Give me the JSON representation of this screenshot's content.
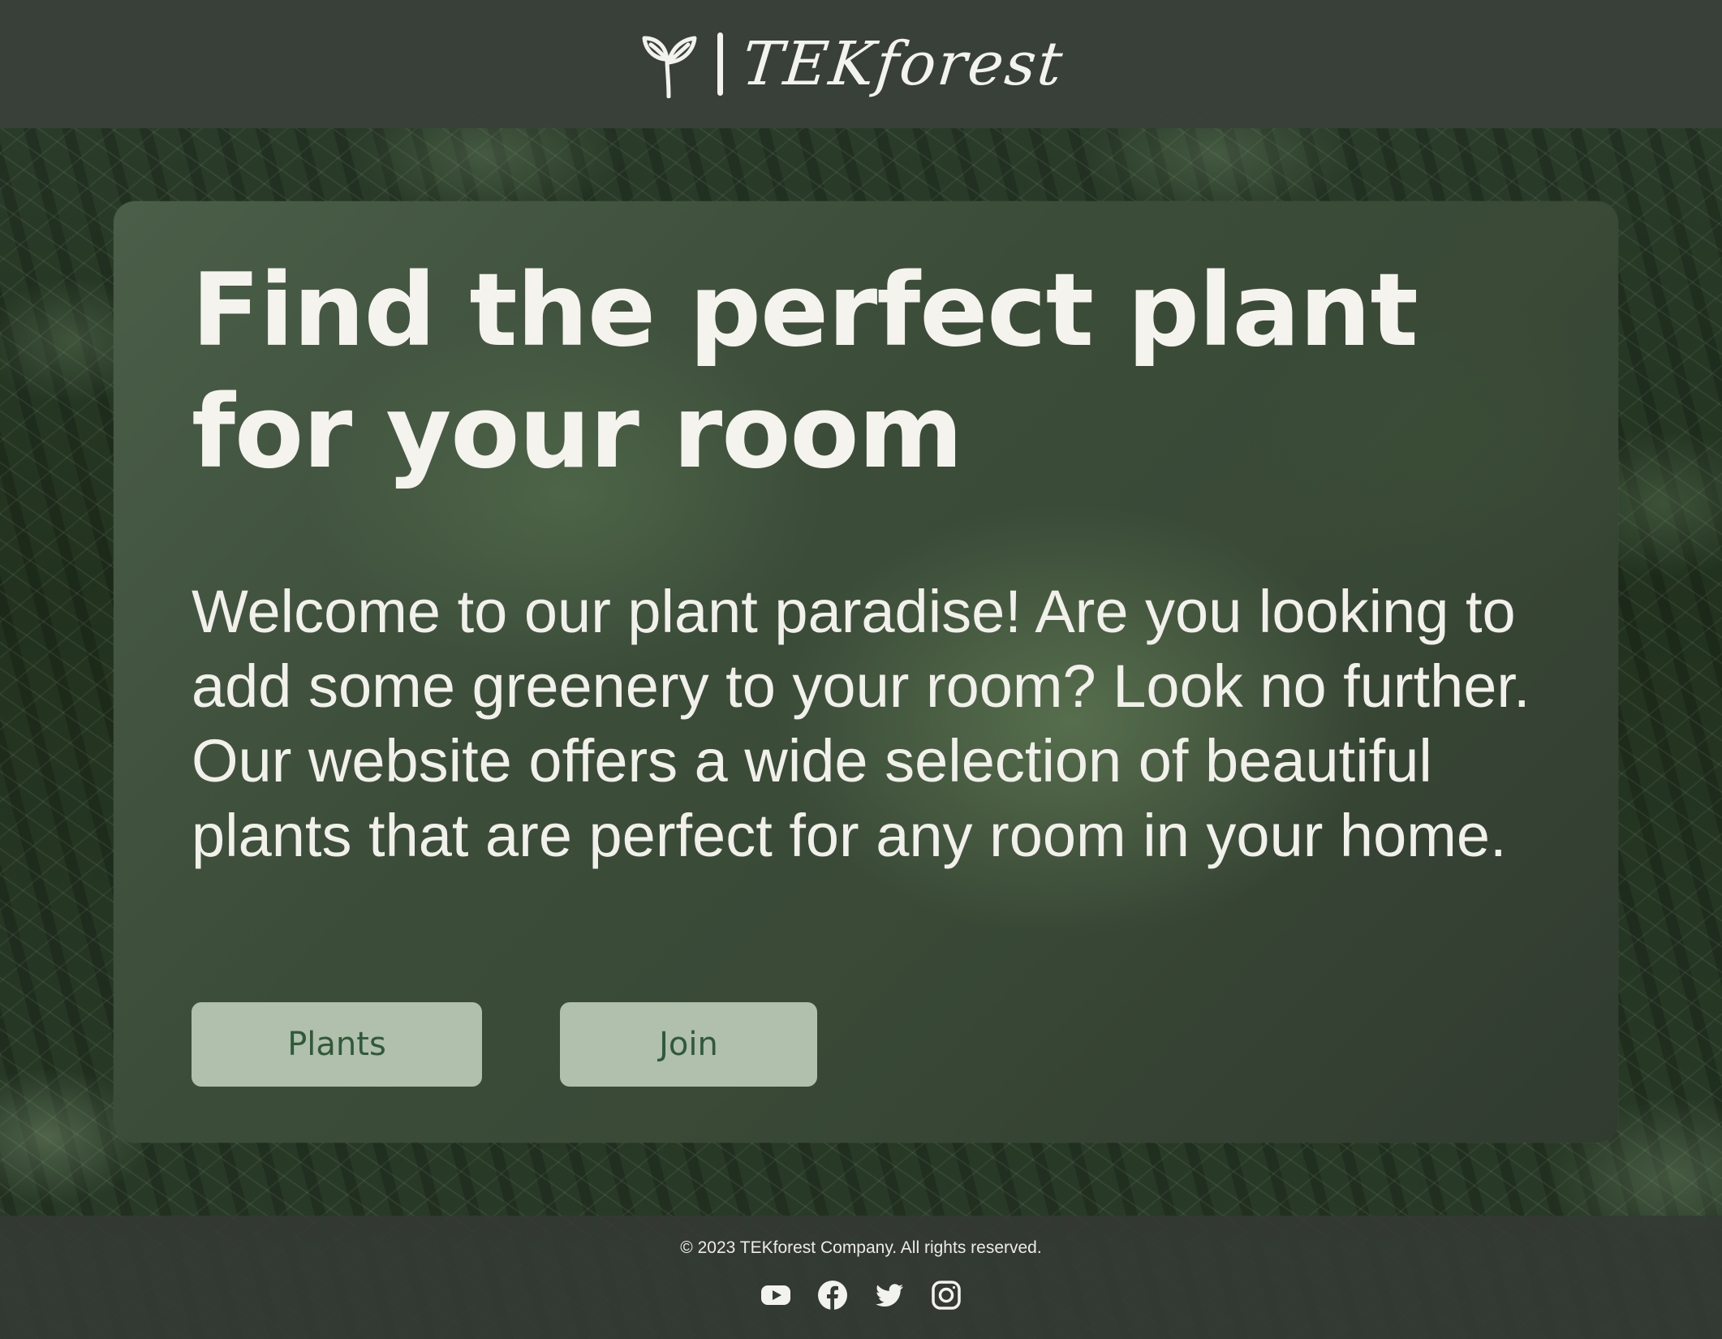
{
  "header": {
    "logo_text": "TEKforest",
    "logo_icon": "sprout-icon"
  },
  "hero": {
    "title": "Find the perfect plant for your room",
    "text": "Welcome to our plant paradise! Are you looking to add some greenery to your room? Look no further. Our website offers a wide selection of beautiful plants that are perfect for any room in your home.",
    "buttons": [
      {
        "label": "Plants"
      },
      {
        "label": "Join"
      }
    ]
  },
  "footer": {
    "copyright": "© 2023 TEKforest Company. All rights reserved.",
    "social": [
      {
        "icon": "youtube-icon"
      },
      {
        "icon": "facebook-icon"
      },
      {
        "icon": "twitter-icon"
      },
      {
        "icon": "instagram-icon"
      }
    ]
  },
  "colors": {
    "header_bg": "#3a403a",
    "card_bg": "#3e503c",
    "text": "#f5f3ee",
    "button_bg": "#b1bfad",
    "button_text": "#2f5a38"
  }
}
